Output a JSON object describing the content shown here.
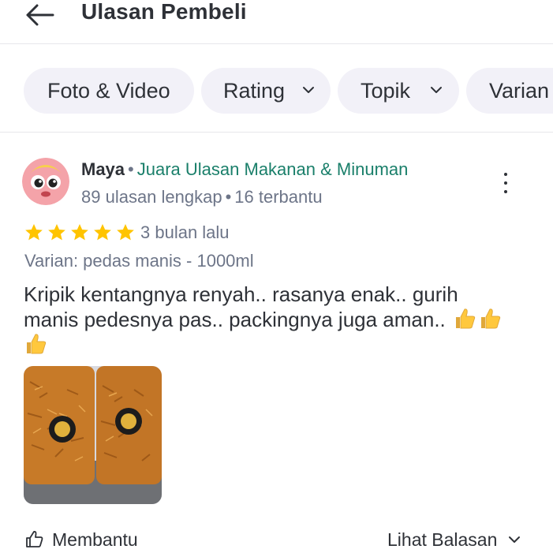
{
  "header": {
    "title": "Ulasan Pembeli",
    "back_icon": "arrow-left-icon"
  },
  "filters": [
    {
      "label": "Foto & Video",
      "has_dropdown": false
    },
    {
      "label": "Rating",
      "has_dropdown": true
    },
    {
      "label": "Topik",
      "has_dropdown": true
    },
    {
      "label": "Varian",
      "has_dropdown": false
    }
  ],
  "review": {
    "user_name": "Maya",
    "separator": "•",
    "badge": "Juara Ulasan Makanan & Minuman",
    "review_count": "89 ulasan lengkap",
    "helpful_count": "16 terbantu",
    "rating": 5,
    "rating_max": 5,
    "time_ago": "3 bulan lalu",
    "variant": "Varian: pedas manis - 1000ml",
    "text_line1": "Kripik kentangnya renyah.. rasanya enak.. gurih",
    "text_line2": "manis pedesnya pas.. packingnya juga aman..",
    "helpful_label": "Membantu",
    "replies_label": "Lihat Balasan"
  },
  "colors": {
    "chip_bg": "#f2f1f8",
    "badge_green": "#1a7f6a",
    "star_yellow": "#ffc400",
    "text_primary": "#2e3137",
    "text_secondary": "#6d7588"
  }
}
